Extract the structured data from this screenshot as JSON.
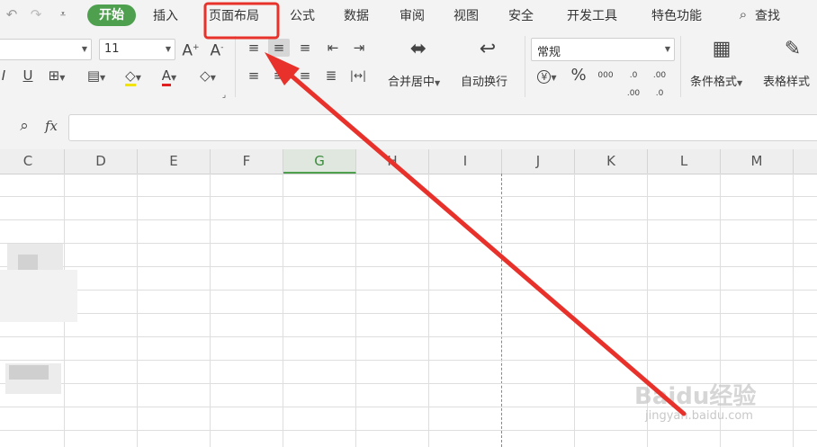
{
  "menu": {
    "home": "开始",
    "insert": "插入",
    "page_layout": "页面布局",
    "formulas": "公式",
    "data": "数据",
    "review": "审阅",
    "view": "视图",
    "security": "安全",
    "dev_tools": "开发工具",
    "special": "特色功能",
    "search": "查找"
  },
  "ribbon": {
    "font_size": "11",
    "number_format": "常规",
    "merge_center": "合并居中",
    "wrap_text": "自动换行",
    "conditional_format": "条件格式",
    "table_style": "表格样式",
    "thousands_sep": "000",
    "inc_decimal": ".0 .00",
    "dec_decimal": ".00 .0",
    "percent": "%",
    "currency": "¥"
  },
  "formula_bar": {
    "fx": "fx",
    "value": ""
  },
  "columns": [
    "C",
    "D",
    "E",
    "F",
    "G",
    "H",
    "I",
    "J",
    "K",
    "L",
    "M"
  ],
  "selected_column": "G",
  "watermark": {
    "brand": "Baidu经验",
    "url": "jingyan.baidu.com"
  },
  "annotation": {
    "highlight_color": "#e8312a",
    "arrow_color": "#e8312a"
  },
  "colors": {
    "accent": "#4ea04f",
    "ribbon_bg": "#f3f3f3"
  }
}
